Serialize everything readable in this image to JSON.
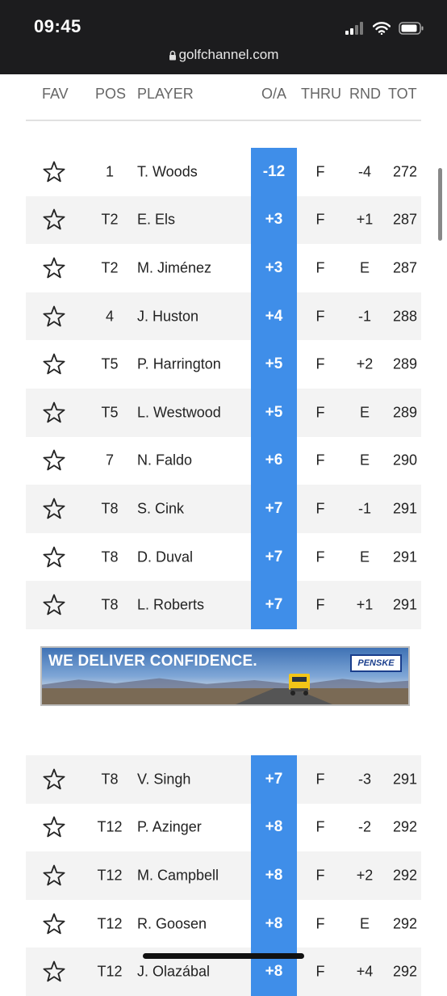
{
  "status_bar": {
    "time": "09:45",
    "url": "golfchannel.com"
  },
  "header": {
    "fav": "FAV",
    "pos": "POS",
    "player": "PLAYER",
    "oa": "O/A",
    "thru": "THRU",
    "rnd": "RND",
    "tot": "TOT"
  },
  "rows_top": [
    {
      "pos": "1",
      "player": "T. Woods",
      "oa": "-12",
      "thru": "F",
      "rnd": "-4",
      "tot": "272"
    },
    {
      "pos": "T2",
      "player": "E. Els",
      "oa": "+3",
      "thru": "F",
      "rnd": "+1",
      "tot": "287"
    },
    {
      "pos": "T2",
      "player": "M. Jiménez",
      "oa": "+3",
      "thru": "F",
      "rnd": "E",
      "tot": "287"
    },
    {
      "pos": "4",
      "player": "J. Huston",
      "oa": "+4",
      "thru": "F",
      "rnd": "-1",
      "tot": "288"
    },
    {
      "pos": "T5",
      "player": "P. Harrington",
      "oa": "+5",
      "thru": "F",
      "rnd": "+2",
      "tot": "289"
    },
    {
      "pos": "T5",
      "player": "L. Westwood",
      "oa": "+5",
      "thru": "F",
      "rnd": "E",
      "tot": "289"
    },
    {
      "pos": "7",
      "player": "N. Faldo",
      "oa": "+6",
      "thru": "F",
      "rnd": "E",
      "tot": "290"
    },
    {
      "pos": "T8",
      "player": "S. Cink",
      "oa": "+7",
      "thru": "F",
      "rnd": "-1",
      "tot": "291"
    },
    {
      "pos": "T8",
      "player": "D. Duval",
      "oa": "+7",
      "thru": "F",
      "rnd": "E",
      "tot": "291"
    },
    {
      "pos": "T8",
      "player": "L. Roberts",
      "oa": "+7",
      "thru": "F",
      "rnd": "+1",
      "tot": "291"
    }
  ],
  "ad": {
    "text": "WE DELIVER CONFIDENCE.",
    "brand": "PENSKE"
  },
  "rows_bottom": [
    {
      "pos": "T8",
      "player": "V. Singh",
      "oa": "+7",
      "thru": "F",
      "rnd": "-3",
      "tot": "291"
    },
    {
      "pos": "T12",
      "player": "P. Azinger",
      "oa": "+8",
      "thru": "F",
      "rnd": "-2",
      "tot": "292"
    },
    {
      "pos": "T12",
      "player": "M. Campbell",
      "oa": "+8",
      "thru": "F",
      "rnd": "+2",
      "tot": "292"
    },
    {
      "pos": "T12",
      "player": "R. Goosen",
      "oa": "+8",
      "thru": "F",
      "rnd": "E",
      "tot": "292"
    },
    {
      "pos": "T12",
      "player": "J. Olazábal",
      "oa": "+8",
      "thru": "F",
      "rnd": "+4",
      "tot": "292"
    }
  ],
  "colors": {
    "accent": "#3f8ee9",
    "status_bar": "#1c1c1e",
    "alt_row": "#f3f3f3"
  },
  "icons": {
    "favorite": "star-outline-icon",
    "lock": "lock-icon",
    "signal": "signal-icon",
    "wifi": "wifi-icon",
    "battery": "battery-icon"
  }
}
